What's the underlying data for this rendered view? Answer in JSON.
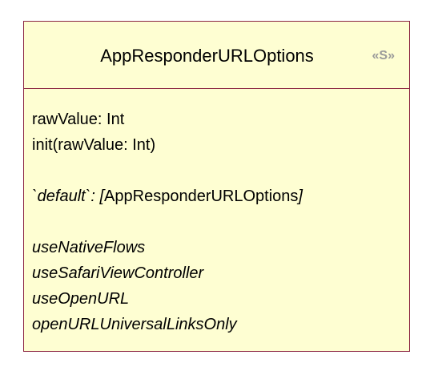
{
  "class_box": {
    "name": "AppResponderURLOptions",
    "stereotype": "«S»",
    "colors": {
      "border": "#8b2542",
      "fill": "#fefed2",
      "stereotype_text": "#9a9a9a"
    }
  },
  "members": {
    "property": "rawValue: Int",
    "initializer": "init(rawValue: Int)",
    "static_default_name": "`default`",
    "static_default_type": ": [AppResponderURLOptions]",
    "options": [
      "useNativeFlows",
      "useSafariViewController",
      "useOpenURL",
      "openURLUniversalLinksOnly"
    ]
  }
}
